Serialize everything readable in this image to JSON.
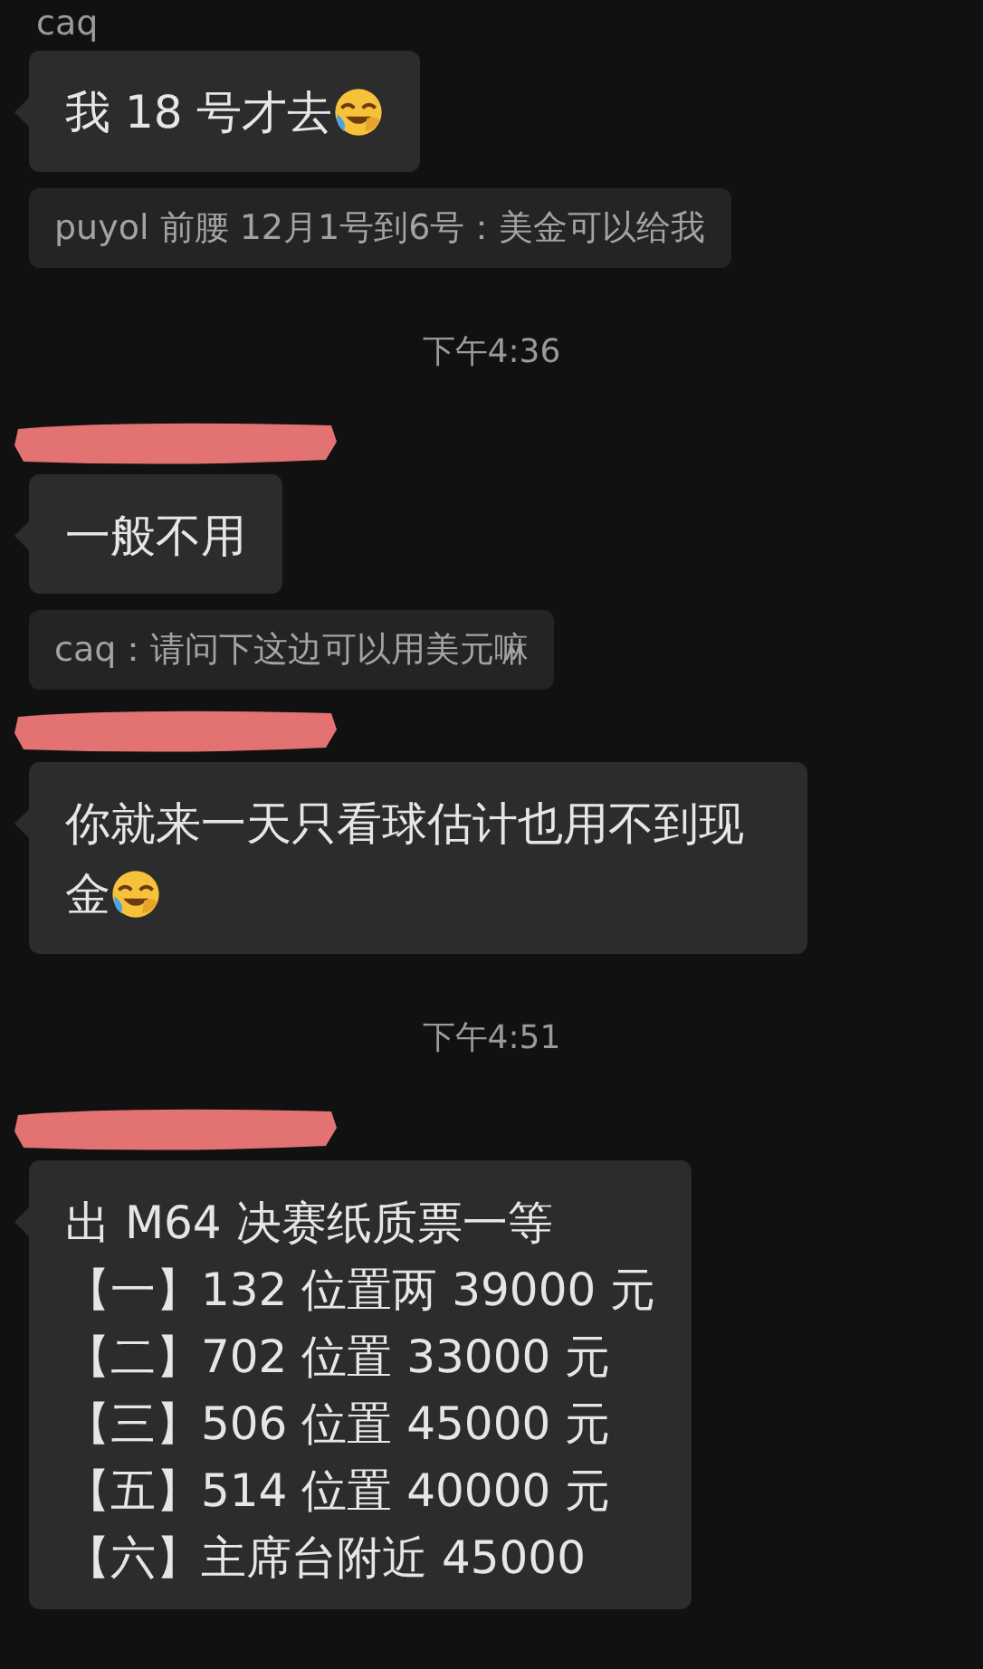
{
  "messages": [
    {
      "kind": "message",
      "sender": "caq",
      "sender_hidden": false,
      "text": "我 18 号才去",
      "emoji": true
    },
    {
      "kind": "quote",
      "text": "puyol 前腰 12月1号到6号：美金可以给我"
    },
    {
      "kind": "time",
      "text": "下午4:36"
    },
    {
      "kind": "message",
      "sender_hidden": true,
      "text": "一般不用",
      "emoji": false
    },
    {
      "kind": "quote",
      "text": "caq：请问下这边可以用美元嘛"
    },
    {
      "kind": "message",
      "sender_hidden": true,
      "text": "你就来一天只看球估计也用不到现金",
      "emoji": true
    },
    {
      "kind": "time",
      "text": "下午4:51"
    },
    {
      "kind": "list_message",
      "sender_hidden": true,
      "lines": [
        "出 M64 决赛纸质票一等",
        "【一】132 位置两 39000 元",
        "【二】702 位置 33000 元",
        "【三】506 位置 45000 元",
        "【五】514 位置 40000 元",
        "【六】主席台附近 45000"
      ]
    }
  ]
}
